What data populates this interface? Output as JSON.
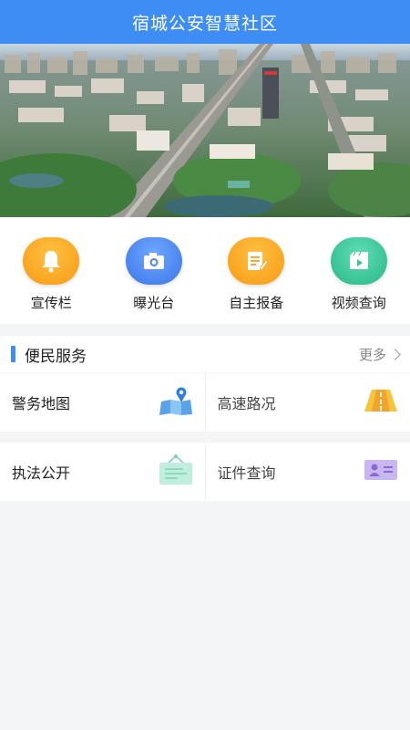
{
  "header": {
    "title": "宿城公安智慧社区"
  },
  "quick_actions": [
    {
      "label": "宣传栏",
      "icon": "bell-icon",
      "color": "#f7a21b"
    },
    {
      "label": "曝光台",
      "icon": "camera-icon",
      "color": "#4a84f0"
    },
    {
      "label": "自主报备",
      "icon": "edit-note-icon",
      "color": "#f7a21b"
    },
    {
      "label": "视频查询",
      "icon": "video-icon",
      "color": "#35c495"
    }
  ],
  "services": {
    "title": "便民服务",
    "more_label": "更多",
    "items": [
      {
        "label": "警务地图",
        "icon": "map-icon"
      },
      {
        "label": "高速路况",
        "icon": "road-icon"
      },
      {
        "label": "执法公开",
        "icon": "notice-board-icon"
      },
      {
        "label": "证件查询",
        "icon": "id-card-icon"
      }
    ]
  },
  "colors": {
    "brand": "#3d8df5",
    "background": "#f4f5f7"
  }
}
